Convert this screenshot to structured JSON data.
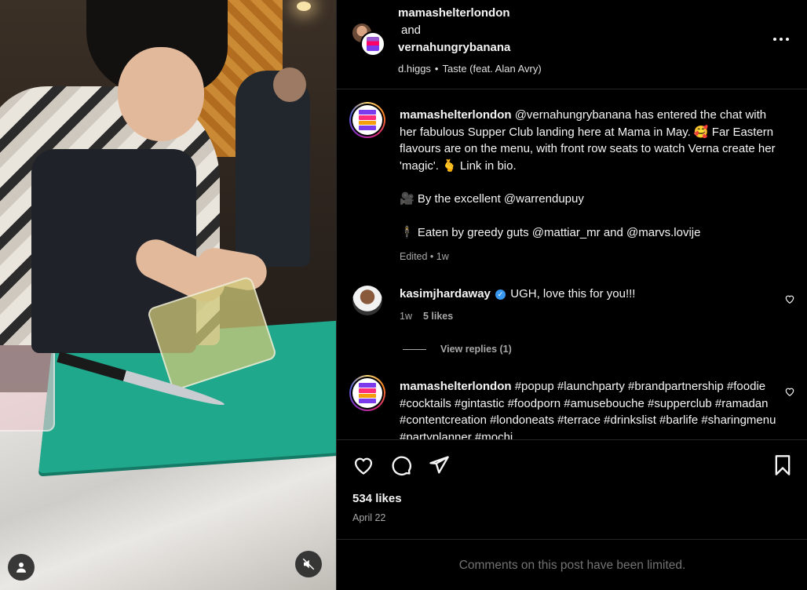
{
  "header": {
    "user1": "mamashelterlondon",
    "and": "and",
    "user2": "vernahungrybanana",
    "audio_artist": "d.higgs",
    "audio_separator": "•",
    "audio_track": "Taste (feat. Alan Avry)",
    "more_icon": "more-horizontal-icon"
  },
  "caption": {
    "username": "mamashelterlondon",
    "line1": "@vernahungrybanana has entered the chat with her fabulous Supper Club landing here at Mama in May. 🥰 Far Eastern flavours are on the menu, with front row seats to watch Verna create her 'magic'. 🫰 Link in bio.",
    "line2": "🎥 By the excellent @warrendupuy",
    "line3": "🕴 Eaten by greedy guts @mattiar_mr and @marvs.lovije",
    "meta": "Edited • 1w"
  },
  "comment1": {
    "username": "kasimjhardaway",
    "verified": "✓",
    "text": "UGH, love this for you!!!",
    "time": "1w",
    "likes": "5 likes",
    "view_replies": "View replies (1)"
  },
  "comment2": {
    "username": "mamashelterlondon",
    "text": "#popup #launchparty #brandpartnership #foodie #cocktails #gintastic #foodporn #amusebouche #supperclub #ramadan #contentcreation #londoneats #terrace #drinkslist #barlife #sharingmenu #partyplanner #mochi"
  },
  "actions": {
    "likes": "534 likes",
    "date": "April 22"
  },
  "footer": {
    "limited": "Comments on this post have been limited."
  },
  "colors": {
    "background": "#000000",
    "text": "#f5f5f5",
    "secondary": "#a8a8a8",
    "verified": "#3897f0"
  }
}
